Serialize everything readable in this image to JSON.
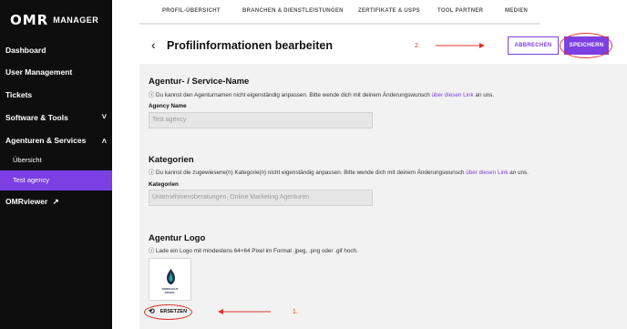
{
  "sidebar": {
    "logo_omr": "OMR",
    "logo_manager": "MANAGER",
    "items": [
      {
        "label": "Dashboard"
      },
      {
        "label": "User Management"
      },
      {
        "label": "Tickets"
      },
      {
        "label": "Software & Tools",
        "chevron": "˅"
      },
      {
        "label": "Agenturen & Services",
        "chevron": "˄"
      },
      {
        "label": "OMRviewer",
        "icon": "↗"
      }
    ],
    "subitems": [
      {
        "label": "Übersicht"
      },
      {
        "label": "Test agency"
      }
    ]
  },
  "tabs": [
    {
      "label": "PROFIL-ÜBERSICHT"
    },
    {
      "label": "BRANCHEN & DIENSTLEISTUNGEN"
    },
    {
      "label": "ZERTIFIKATE & USPS"
    },
    {
      "label": "TOOL PARTNER"
    },
    {
      "label": "MEDIEN"
    }
  ],
  "header": {
    "title": "Profilinformationen bearbeiten",
    "cancel_label": "ABBRECHEN",
    "save_label": "SPEICHERN",
    "annot_2": "2.",
    "annot_1": "1."
  },
  "sections": {
    "agency": {
      "title": "Agentur- / Service-Name",
      "info": "ⓘ Du kannst den Agenturnamen nicht eigenständig anpassen. Bitte wende dich mit deinem Änderungswunsch ",
      "link": "über diesen Link",
      "info_end": " an uns.",
      "field_label": "Agency Name",
      "field_value": "Test agency"
    },
    "categories": {
      "title": "Kategorien",
      "info": "ⓘ Du kannst die zugewiesene(n) Kategorie(n) nicht eigenständig anpassen. Bitte wende dich mit deinem Änderungswunsch ",
      "link": "über diesen Link",
      "info_end": " an uns.",
      "field_label": "Kategorien",
      "field_value": "Unternehmensberatungen, Online Marketing Agenturen"
    },
    "logo": {
      "title": "Agentur Logo",
      "info": "ⓘ Lade ein Logo mit mindestens 64×64 Pixel im Format .jpeg, .png oder .gif hoch.",
      "logo_text_1": "NORDLICHT",
      "logo_text_2": "DIGITAL",
      "replace_label": "ERSETZEN"
    }
  },
  "colors": {
    "accent": "#7b3fe4",
    "sidebar_bg": "#0e0e0e",
    "annotation": "#e0332b"
  }
}
